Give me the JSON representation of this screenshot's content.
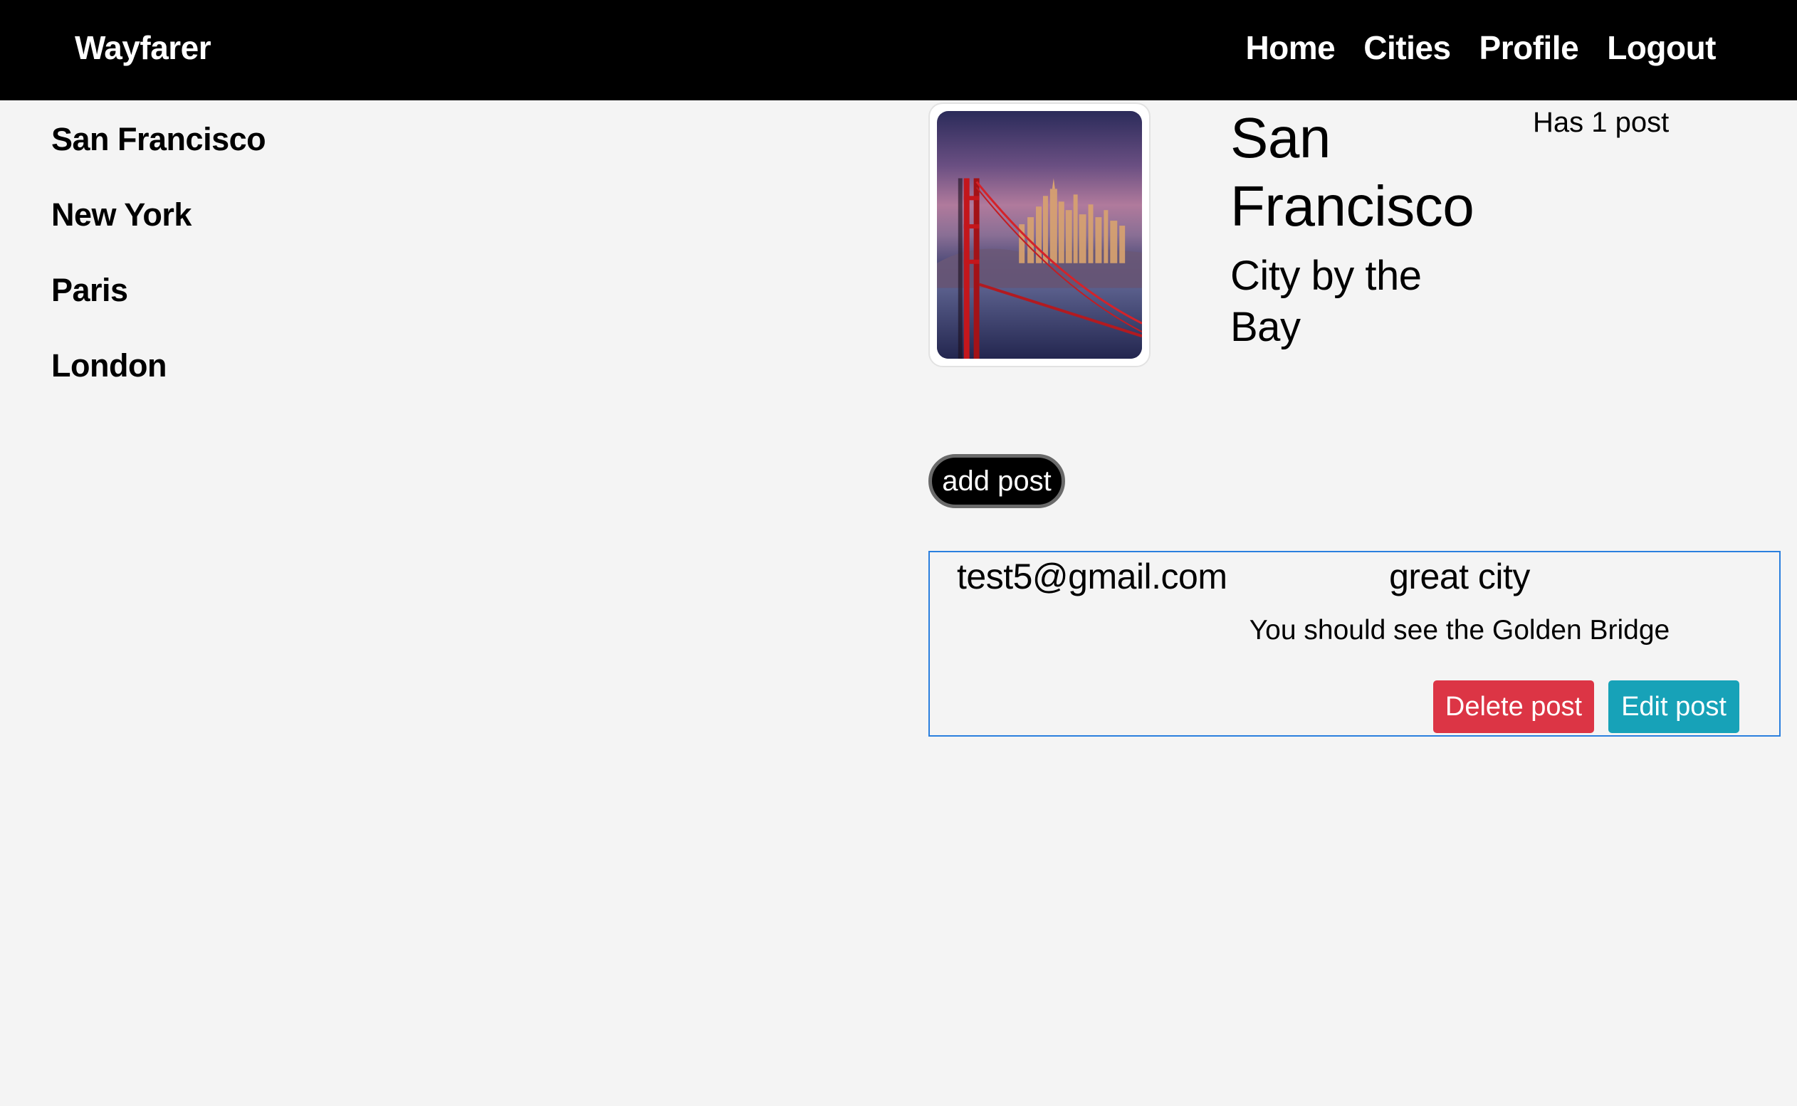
{
  "navbar": {
    "brand": "Wayfarer",
    "links": [
      "Home",
      "Cities",
      "Profile",
      "Logout"
    ]
  },
  "cities": [
    "San Francisco",
    "New York",
    "Paris",
    "London"
  ],
  "city_detail": {
    "image": "golden-gate-bridge-photo",
    "name": "San Francisco",
    "tagline": "City by the Bay",
    "post_count": "Has 1 post",
    "add_post_label": "add post"
  },
  "posts": [
    {
      "author": "test5@gmail.com",
      "title": "great city",
      "body": "You should see the Golden Bridge",
      "delete_label": "Delete post",
      "edit_label": "Edit post"
    }
  ],
  "colors": {
    "navbar_bg": "#000000",
    "page_bg": "#f4f4f4",
    "delete": "#dc3545",
    "edit": "#17a2b8",
    "card_border": "#2a7fde"
  }
}
